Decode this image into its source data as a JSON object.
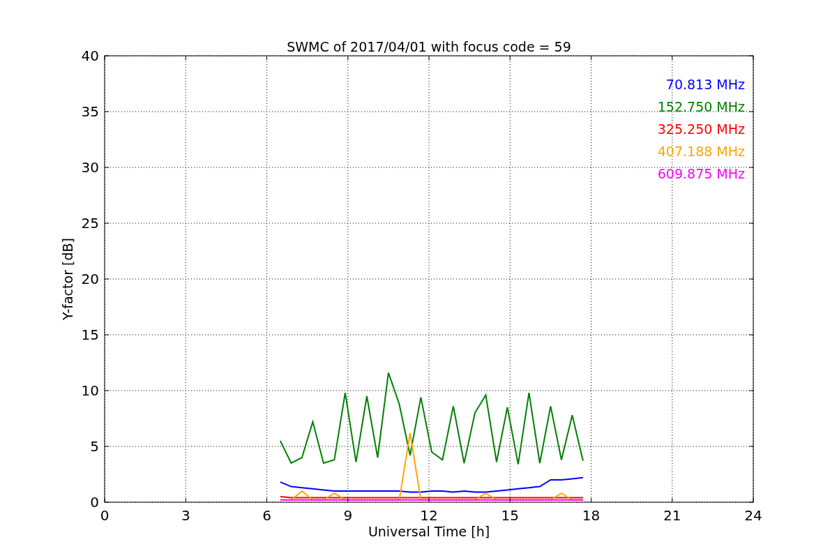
{
  "chart_data": {
    "type": "line",
    "title": "SWMC of 2017/04/01 with focus code = 59",
    "xlabel": "Universal Time [h]",
    "ylabel": "Y-factor [dB]",
    "x": [
      6.5,
      6.9,
      7.3,
      7.7,
      8.1,
      8.5,
      8.9,
      9.3,
      9.7,
      10.1,
      10.5,
      10.9,
      11.3,
      11.7,
      12.1,
      12.5,
      12.9,
      13.3,
      13.7,
      14.1,
      14.5,
      14.9,
      15.3,
      15.7,
      16.1,
      16.5,
      16.9,
      17.3,
      17.7
    ],
    "series": [
      {
        "name": "70.813 MHz",
        "color": "#0000ff",
        "values": [
          1.8,
          1.4,
          1.3,
          1.2,
          1.1,
          1.0,
          1.0,
          1.0,
          1.0,
          1.0,
          1.0,
          1.0,
          0.9,
          0.9,
          1.0,
          1.0,
          0.9,
          1.0,
          0.9,
          0.9,
          1.0,
          1.1,
          1.2,
          1.3,
          1.4,
          2.0,
          2.0,
          2.1,
          2.2
        ]
      },
      {
        "name": "152.750 MHz",
        "color": "#008000",
        "values": [
          5.5,
          3.5,
          4.0,
          7.2,
          3.5,
          3.8,
          9.8,
          3.6,
          9.5,
          4.0,
          11.6,
          8.8,
          4.2,
          9.4,
          4.5,
          3.8,
          8.6,
          3.5,
          8.0,
          9.6,
          3.6,
          8.5,
          3.4,
          9.8,
          3.5,
          8.6,
          3.8,
          7.8,
          3.7
        ]
      },
      {
        "name": "325.250 MHz",
        "color": "#ff0000",
        "values": [
          0.5,
          0.4,
          0.4,
          0.4,
          0.4,
          0.4,
          0.4,
          0.4,
          0.4,
          0.4,
          0.4,
          0.4,
          0.4,
          0.4,
          0.4,
          0.4,
          0.4,
          0.4,
          0.4,
          0.4,
          0.4,
          0.4,
          0.4,
          0.4,
          0.4,
          0.4,
          0.4,
          0.4,
          0.4
        ]
      },
      {
        "name": "407.188 MHz",
        "color": "#ffa500",
        "values": [
          null,
          0.2,
          1.0,
          0.2,
          0.2,
          0.8,
          0.2,
          0.2,
          0.2,
          0.2,
          0.2,
          0.2,
          6.2,
          0.2,
          0.2,
          0.2,
          0.2,
          0.2,
          0.2,
          0.8,
          0.2,
          0.2,
          0.2,
          0.2,
          0.2,
          0.2,
          0.8,
          0.2,
          0.2
        ]
      },
      {
        "name": "609.875 MHz",
        "color": "#ff00ff",
        "values": [
          0.2,
          0.2,
          0.2,
          0.2,
          0.2,
          0.2,
          0.2,
          0.2,
          0.2,
          0.2,
          0.2,
          0.2,
          0.2,
          0.2,
          0.2,
          0.2,
          0.2,
          0.2,
          0.2,
          0.2,
          0.2,
          0.2,
          0.2,
          0.2,
          0.2,
          0.2,
          0.2,
          0.2,
          0.2
        ]
      }
    ],
    "grid": true,
    "xlim": [
      0,
      24
    ],
    "ylim": [
      0,
      40
    ],
    "xticks": [
      0,
      3,
      6,
      9,
      12,
      15,
      18,
      21,
      24
    ],
    "yticks": [
      0,
      5,
      10,
      15,
      20,
      25,
      30,
      35,
      40
    ]
  }
}
